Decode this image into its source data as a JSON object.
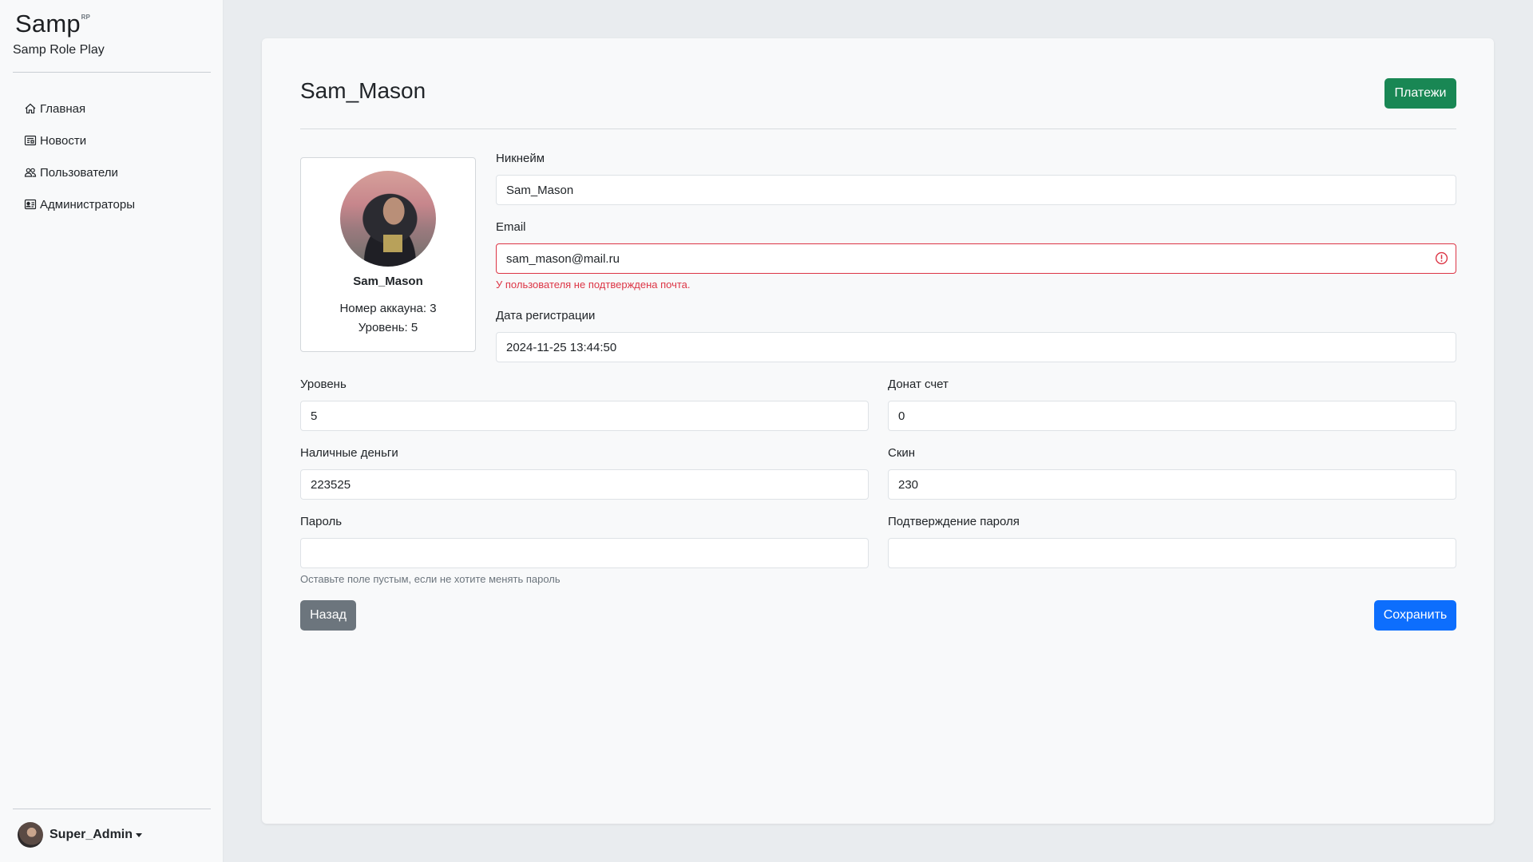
{
  "sidebar": {
    "brand": "Samp",
    "brand_sup": "RP",
    "subtitle": "Samp Role Play",
    "nav": [
      {
        "label": "Главная",
        "icon": "house-icon"
      },
      {
        "label": "Новости",
        "icon": "newspaper-icon"
      },
      {
        "label": "Пользователи",
        "icon": "people-icon"
      },
      {
        "label": "Администраторы",
        "icon": "person-vcard-icon"
      }
    ],
    "user": {
      "name": "Super_Admin"
    }
  },
  "header": {
    "title": "Sam_Mason",
    "payments_button": "Платежи"
  },
  "profile": {
    "name": "Sam_Mason",
    "account_line": "Номер аккауна: 3",
    "level_line": "Уровень: 5"
  },
  "form": {
    "nickname": {
      "label": "Никнейм",
      "value": "Sam_Mason"
    },
    "email": {
      "label": "Email",
      "value": "sam_mason@mail.ru",
      "error": "У пользователя не подтверждена почта."
    },
    "reg_date": {
      "label": "Дата регистрации",
      "value": "2024-11-25 13:44:50"
    },
    "level": {
      "label": "Уровень",
      "value": "5"
    },
    "donate": {
      "label": "Донат счет",
      "value": "0"
    },
    "cash": {
      "label": "Наличные деньги",
      "value": "223525"
    },
    "skin": {
      "label": "Скин",
      "value": "230"
    },
    "password": {
      "label": "Пароль",
      "value": "",
      "help": "Оставьте поле пустым, если не хотите менять пароль"
    },
    "password_confirm": {
      "label": "Подтверждение пароля",
      "value": ""
    }
  },
  "actions": {
    "back": "Назад",
    "save": "Сохранить"
  },
  "colors": {
    "success": "#198754",
    "primary": "#0d6efd",
    "secondary": "#6c757d",
    "danger": "#dc3545"
  }
}
